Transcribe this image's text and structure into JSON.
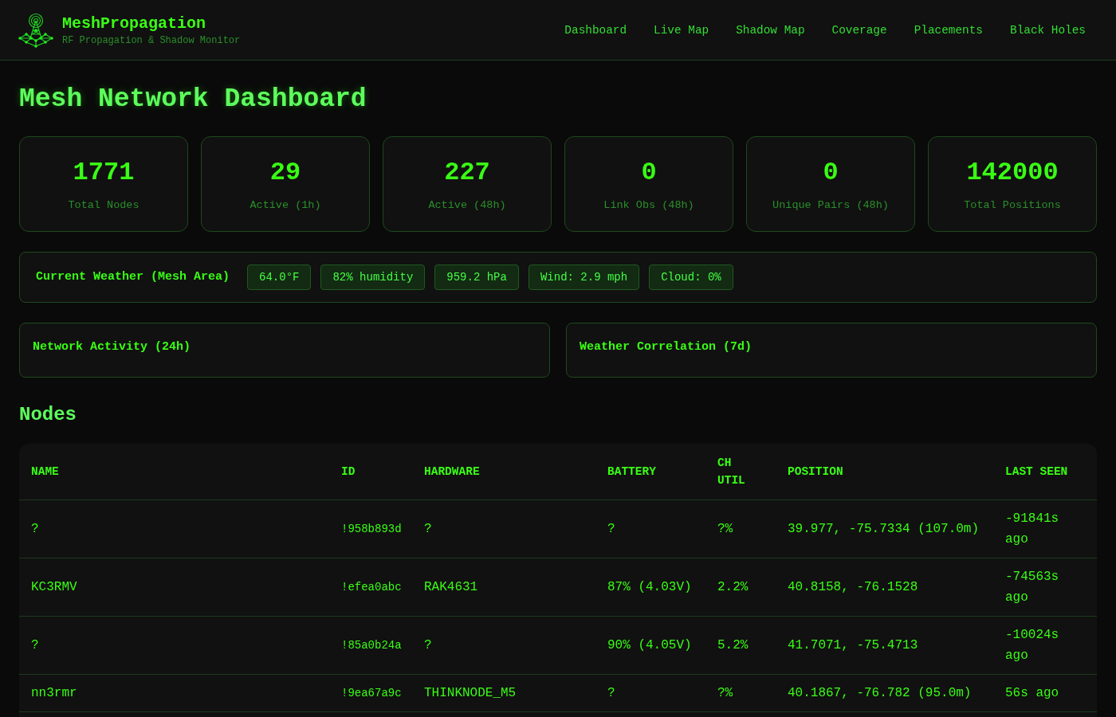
{
  "app": {
    "title": "MeshPropagation",
    "subtitle": "RF Propagation & Shadow Monitor"
  },
  "nav": [
    "Dashboard",
    "Live Map",
    "Shadow Map",
    "Coverage",
    "Placements",
    "Black Holes"
  ],
  "page_title": "Mesh Network Dashboard",
  "stats": [
    {
      "value": "1771",
      "label": "Total Nodes"
    },
    {
      "value": "29",
      "label": "Active (1h)"
    },
    {
      "value": "227",
      "label": "Active (48h)"
    },
    {
      "value": "0",
      "label": "Link Obs (48h)"
    },
    {
      "value": "0",
      "label": "Unique Pairs (48h)"
    },
    {
      "value": "142000",
      "label": "Total Positions"
    }
  ],
  "weather": {
    "label": "Current Weather (Mesh Area)",
    "readings": [
      "64.0°F",
      "82% humidity",
      "959.2 hPa",
      "Wind: 2.9 mph",
      "Cloud: 0%"
    ]
  },
  "panels": [
    {
      "title": "Network Activity (24h)"
    },
    {
      "title": "Weather Correlation (7d)"
    }
  ],
  "nodes": {
    "title": "Nodes",
    "columns": [
      "NAME",
      "ID",
      "HARDWARE",
      "BATTERY",
      "CH UTIL",
      "POSITION",
      "LAST SEEN"
    ],
    "rows": [
      [
        "?",
        "!958b893d",
        "?",
        "?",
        "?%",
        "39.977, -75.7334 (107.0m)",
        "-91841s ago"
      ],
      [
        "KC3RMV",
        "!efea0abc",
        "RAK4631",
        "87% (4.03V)",
        "2.2%",
        "40.8158, -76.1528",
        "-74563s ago"
      ],
      [
        "?",
        "!85a0b24a",
        "?",
        "90% (4.05V)",
        "5.2%",
        "41.7071, -75.4713",
        "-10024s ago"
      ],
      [
        "nn3rmr",
        "!9ea67a9c",
        "THINKNODE_M5",
        "?",
        "?%",
        "40.1867, -76.782 (95.0m)",
        "56s ago"
      ]
    ]
  }
}
